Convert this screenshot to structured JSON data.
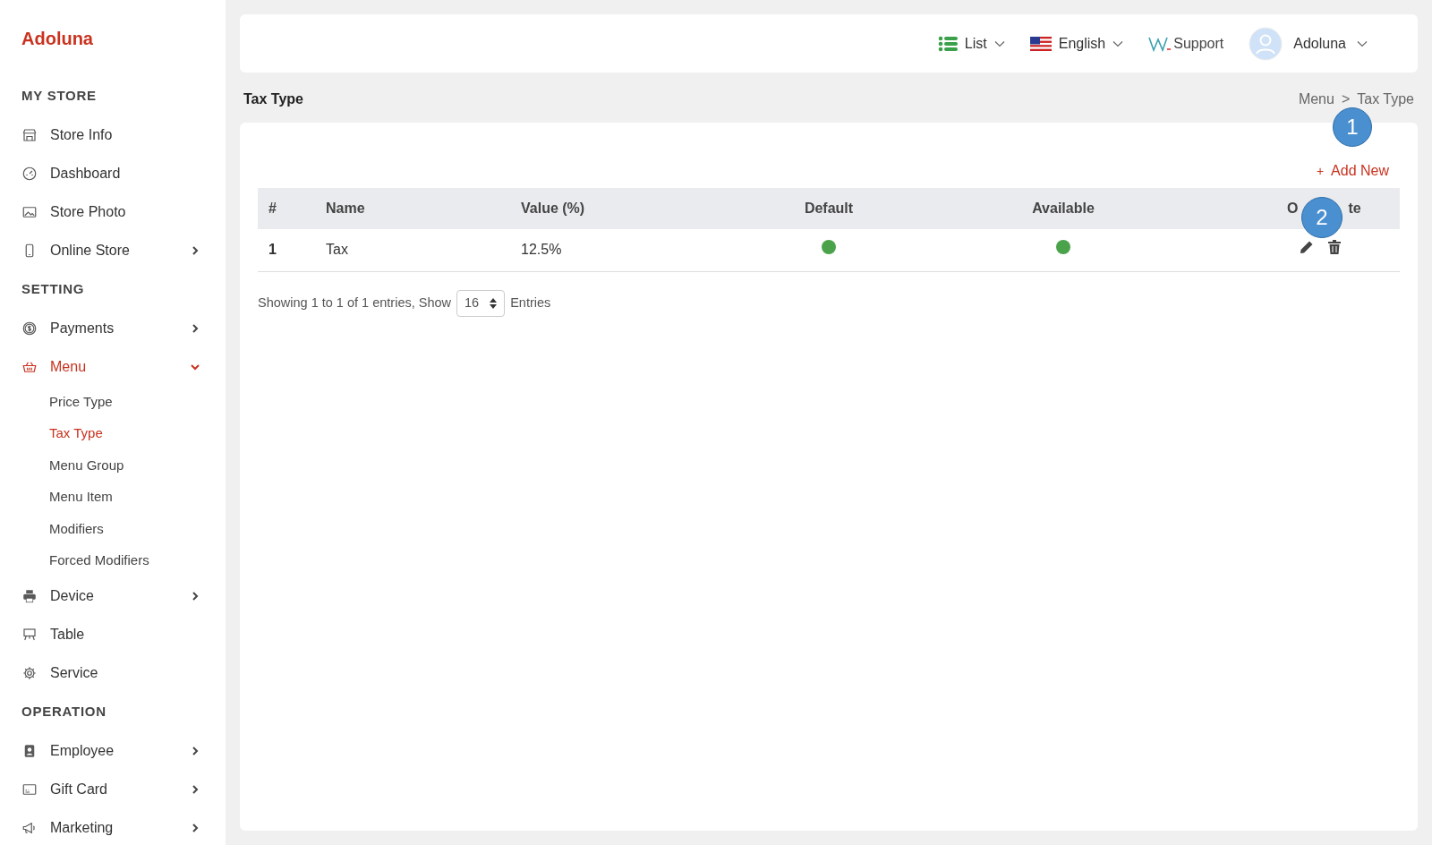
{
  "brand": "Adoluna",
  "sidebar": {
    "sections": [
      {
        "title": "MY STORE",
        "items": [
          {
            "label": "Store Info",
            "has_arrow": false,
            "selected": false
          },
          {
            "label": "Dashboard",
            "has_arrow": false,
            "selected": false
          },
          {
            "label": "Store Photo",
            "has_arrow": false,
            "selected": false
          },
          {
            "label": "Online Store",
            "has_arrow": true,
            "selected": false
          }
        ]
      },
      {
        "title": "SETTING",
        "items": [
          {
            "label": "Payments",
            "has_arrow": true,
            "selected": false
          },
          {
            "label": "Menu",
            "has_arrow": true,
            "selected": true,
            "expanded": true,
            "children": [
              {
                "label": "Price Type",
                "selected": false
              },
              {
                "label": "Tax Type",
                "selected": true
              },
              {
                "label": "Menu Group",
                "selected": false
              },
              {
                "label": "Menu Item",
                "selected": false
              },
              {
                "label": "Modifiers",
                "selected": false
              },
              {
                "label": "Forced Modifiers",
                "selected": false
              }
            ]
          },
          {
            "label": "Device",
            "has_arrow": true,
            "selected": false
          },
          {
            "label": "Table",
            "has_arrow": false,
            "selected": false
          },
          {
            "label": "Service",
            "has_arrow": false,
            "selected": false
          }
        ]
      },
      {
        "title": "OPERATION",
        "items": [
          {
            "label": "Employee",
            "has_arrow": true,
            "selected": false
          },
          {
            "label": "Gift Card",
            "has_arrow": true,
            "selected": false
          },
          {
            "label": "Marketing",
            "has_arrow": true,
            "selected": false
          }
        ]
      }
    ]
  },
  "topbar": {
    "view": "List",
    "language": "English",
    "support": "Support",
    "user": "Adoluna"
  },
  "page_title": "Tax Type",
  "breadcrumb": [
    "Menu",
    "Tax Type"
  ],
  "breadcrumb_separator": ">",
  "add_button": {
    "icon": "+",
    "label": "Add New"
  },
  "table": {
    "columns": [
      "#",
      "Name",
      "Value (%)",
      "Default",
      "Available"
    ],
    "column_6_fragments": [
      "O",
      "te"
    ],
    "rows": [
      {
        "index": "1",
        "name": "Tax",
        "value": "12.5%",
        "default": true,
        "available": true
      }
    ]
  },
  "footer": {
    "text": "Showing 1 to 1 of 1 entries, Show",
    "page_size": "16",
    "suffix": "Entries"
  },
  "callouts": [
    "1",
    "2"
  ]
}
